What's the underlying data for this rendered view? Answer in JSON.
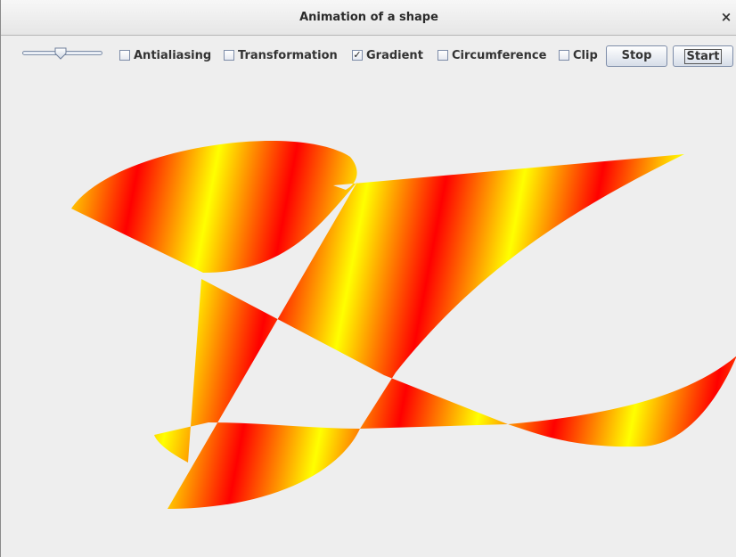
{
  "window": {
    "title": "Animation of a shape",
    "close_label": "×"
  },
  "toolbar": {
    "slider_fraction": 0.48,
    "checkboxes": [
      {
        "label": "Antialiasing",
        "checked": false
      },
      {
        "label": "Transformation",
        "checked": false
      },
      {
        "label": "Gradient",
        "checked": true
      },
      {
        "label": "Circumference",
        "checked": false
      },
      {
        "label": "Clip",
        "checked": false
      }
    ],
    "stop_label": "Stop",
    "start_label": "Start"
  },
  "colors": {
    "gradient_red": "#ff0000",
    "gradient_yellow": "#ffff00",
    "window_bg": "#eeeeee"
  }
}
